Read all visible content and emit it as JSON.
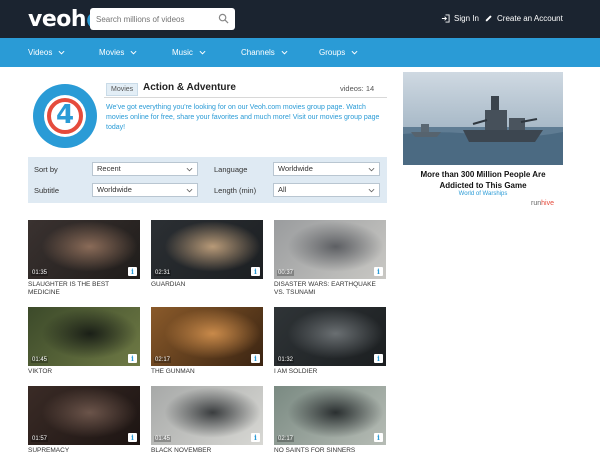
{
  "header": {
    "logo": "veoh",
    "search_placeholder": "Search millions of videos",
    "sign_in": "Sign In",
    "create_account": "Create an Account"
  },
  "nav": {
    "items": [
      {
        "label": "Videos"
      },
      {
        "label": "Movies"
      },
      {
        "label": "Music"
      },
      {
        "label": "Channels"
      },
      {
        "label": "Groups"
      }
    ]
  },
  "group": {
    "badge_number": "4",
    "category_tag": "Movies",
    "title": "Action & Adventure",
    "videos_count": "videos: 14",
    "description": "We've got everything you're looking for on our Veoh.com movies group page. Watch movies online for free, share your favorites and much more! Visit our movies group page today!"
  },
  "filters": {
    "sort_by_label": "Sort by",
    "sort_by_value": "Recent",
    "language_label": "Language",
    "language_value": "Worldwide",
    "subtitle_label": "Subtitle",
    "subtitle_value": "Worldwide",
    "length_label": "Length (min)",
    "length_value": "All"
  },
  "videos": [
    {
      "title": "SLAUGHTER IS THE BEST MEDICINE",
      "duration": "01:35",
      "palette": [
        "#3a3230",
        "#8a6b58",
        "#1f1c1a"
      ]
    },
    {
      "title": "GUARDIAN",
      "duration": "02:31",
      "palette": [
        "#2b2f33",
        "#b89a78",
        "#1c1f22"
      ]
    },
    {
      "title": "DISASTER WARS: EARTHQUAKE VS. TSUNAMI",
      "duration": "00:37",
      "palette": [
        "#9a9c9e",
        "#5d5f63",
        "#c9c8c4"
      ]
    },
    {
      "title": "VIKTOR",
      "duration": "01:45",
      "palette": [
        "#3c4a2a",
        "#1a1f17",
        "#6f7a45"
      ]
    },
    {
      "title": "THE GUNMAN",
      "duration": "02:17",
      "palette": [
        "#8a5a2a",
        "#c98a4a",
        "#3a2412"
      ]
    },
    {
      "title": "I AM SOLDIER",
      "duration": "01:32",
      "palette": [
        "#2f3437",
        "#6a6f72",
        "#1b1e20"
      ]
    },
    {
      "title": "SUPREMACY",
      "duration": "01:57",
      "palette": [
        "#3a2b26",
        "#6b544a",
        "#1c1412"
      ]
    },
    {
      "title": "BLACK NOVEMBER",
      "duration": "01:45",
      "palette": [
        "#a7a9a8",
        "#3a3d3f",
        "#d8d8d4"
      ]
    },
    {
      "title": "NO SAINTS FOR SINNERS",
      "duration": "02:17",
      "palette": [
        "#7a8a82",
        "#2a2f30",
        "#b6bcb5"
      ]
    }
  ],
  "ad": {
    "headline": "More than 300 Million People Are Addicted to This Game",
    "sponsor": "World of Warships",
    "brand_left": "run",
    "brand_right": "hive"
  }
}
